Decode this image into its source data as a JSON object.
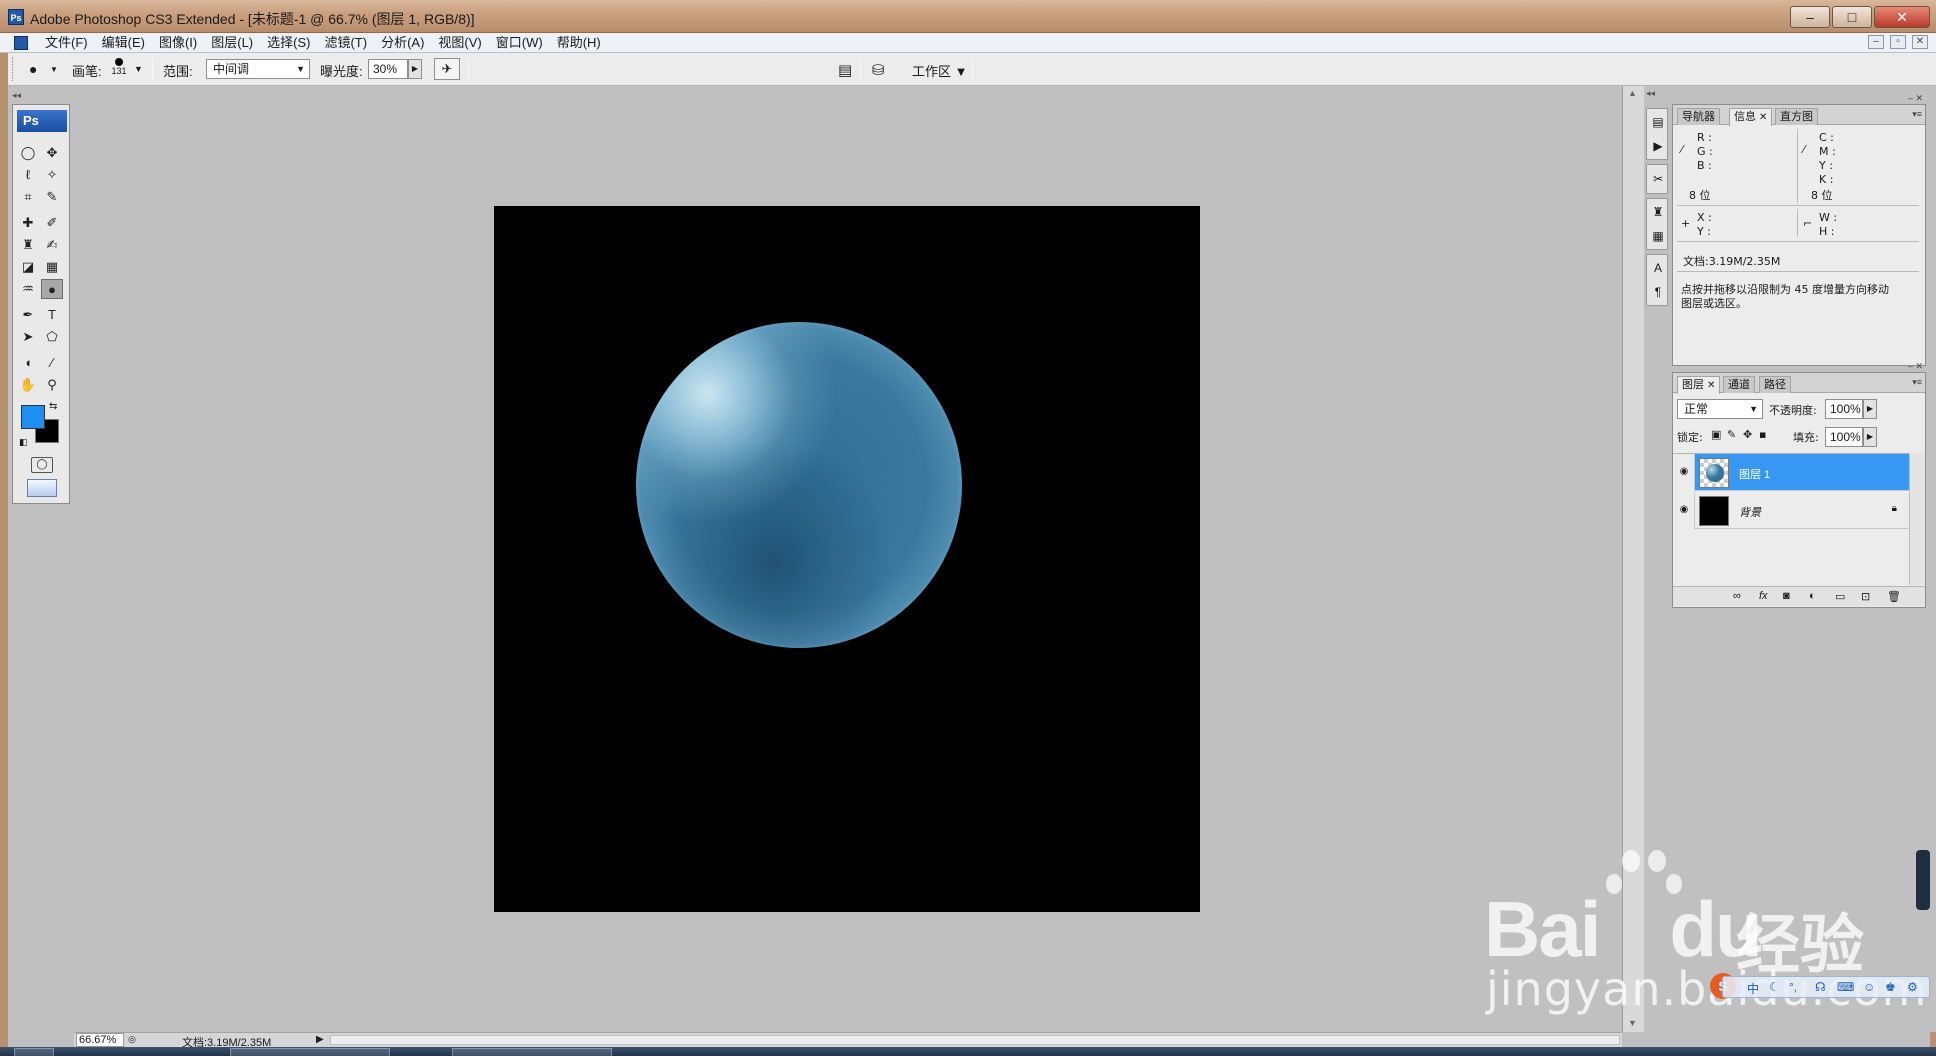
{
  "window": {
    "title": "Adobe Photoshop CS3 Extended - [未标题-1 @ 66.7% (图层 1, RGB/8)]",
    "controls": [
      "–",
      "□",
      "✕"
    ]
  },
  "menu": {
    "items": [
      "文件(F)",
      "编辑(E)",
      "图像(I)",
      "图层(L)",
      "选择(S)",
      "滤镜(T)",
      "分析(A)",
      "视图(V)",
      "窗口(W)",
      "帮助(H)"
    ],
    "mdi_controls": [
      "–",
      "▫",
      "✕"
    ]
  },
  "options_bar": {
    "brush_label": "画笔:",
    "brush_size": "131",
    "range_label": "范围:",
    "range_value": "中间调",
    "exposure_label": "曝光度:",
    "exposure_value": "30%",
    "workspace_label": "工作区"
  },
  "toolbox": {
    "logo": "Ps",
    "foreground_color": "#1d8ff0",
    "background_color": "#000000"
  },
  "document": {
    "canvas_color": "#000000",
    "sphere_color": "#35739a",
    "highlight_color": "#cde8f3"
  },
  "info_panel": {
    "tabs": [
      "导航器",
      "信息",
      "直方图"
    ],
    "active_tab": "信息",
    "rgb_labels": [
      "R :",
      "G :",
      "B :"
    ],
    "cmyk_labels": [
      "C :",
      "M :",
      "Y :",
      "K :"
    ],
    "bit_left": "8 位",
    "bit_right": "8 位",
    "xy_labels": [
      "X :",
      "Y :"
    ],
    "wh_labels": [
      "W :",
      "H :"
    ],
    "doc_size": "文档:3.19M/2.35M",
    "hint_line1": "点按并拖移以沿限制为 45 度增量方向移动",
    "hint_line2": "图层或选区。"
  },
  "layers_panel": {
    "tabs": [
      "图层",
      "通道",
      "路径"
    ],
    "active_tab": "图层",
    "blend_mode": "正常",
    "opacity_label": "不透明度:",
    "opacity_value": "100%",
    "lock_label": "锁定:",
    "fill_label": "填充:",
    "fill_value": "100%",
    "layers": [
      {
        "name": "图层 1",
        "selected": true
      },
      {
        "name": "背景",
        "selected": false,
        "locked": true
      }
    ],
    "bottom_icons": [
      "link-icon",
      "fx-icon",
      "mask-icon",
      "adjustment-icon",
      "group-icon",
      "new-layer-icon",
      "delete-icon"
    ]
  },
  "status_bar": {
    "zoom": "66.67%",
    "doc_info": "文档:3.19M/2.35M"
  },
  "watermark": {
    "brand": "Bai",
    "brand_du": "du",
    "suffix": "经验",
    "url": "jingyan.baidu.com"
  }
}
